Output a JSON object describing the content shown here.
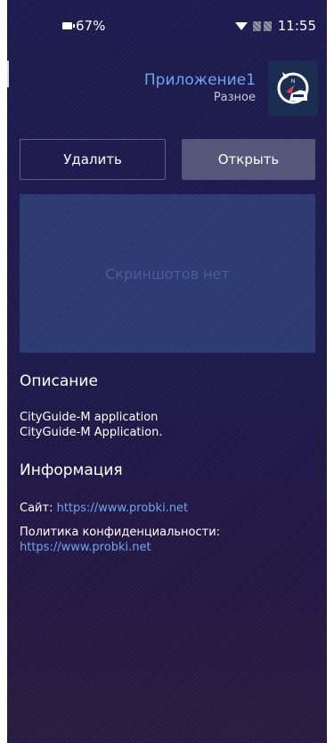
{
  "status_bar": {
    "battery": "67%",
    "time": "11:55"
  },
  "app": {
    "name": "Приложение1",
    "category": "Разное",
    "icon": "compass-car-icon"
  },
  "buttons": {
    "delete_label": "Удалить",
    "open_label": "Открыть"
  },
  "screenshots": {
    "empty_text": "Скриншотов нет"
  },
  "description": {
    "title": "Описание",
    "lines": [
      "CityGuide-M application",
      "CityGuide-M Application."
    ]
  },
  "information": {
    "title": "Информация",
    "site_label": "Сайт:",
    "site_url": "https://www.probki.net",
    "privacy_label": "Политика конфиденциальности:",
    "privacy_url": "https://www.probki.net"
  },
  "colors": {
    "background": "#1c1947",
    "accent_link": "#6fa4f0",
    "open_button": "#55577a",
    "screenshots_box": "#2b3b72"
  }
}
